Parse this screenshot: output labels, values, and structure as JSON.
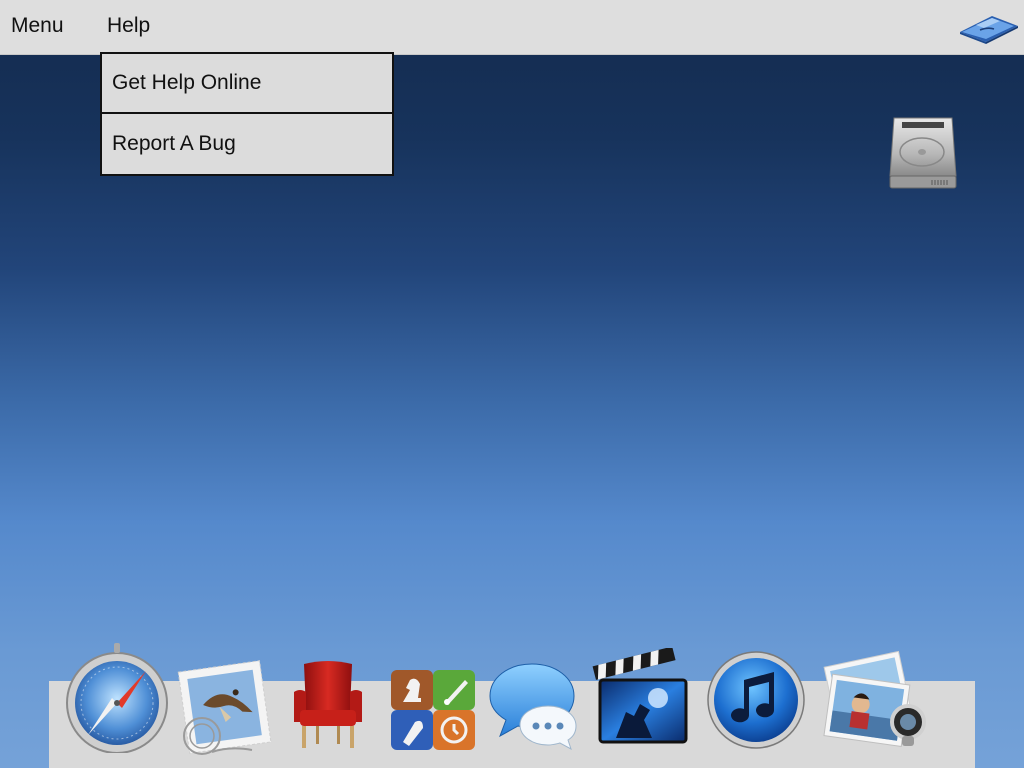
{
  "menubar": {
    "menus": [
      {
        "label": "Menu"
      },
      {
        "label": "Help"
      }
    ],
    "right_icon": "finder-icon"
  },
  "help_menu": {
    "open": true,
    "items": [
      {
        "label": "Get Help Online"
      },
      {
        "label": "Report A Bug"
      }
    ]
  },
  "desktop": {
    "icons": [
      "hard-drive-icon"
    ],
    "background_colors": [
      "#132a4d",
      "#5589cc",
      "#75a2d8"
    ]
  },
  "dock": {
    "icons": [
      "safari-icon",
      "mail-icon",
      "ibooks-chair-icon",
      "game-center-icon",
      "messages-icon",
      "imovie-icon",
      "itunes-icon",
      "preview-icon"
    ]
  }
}
